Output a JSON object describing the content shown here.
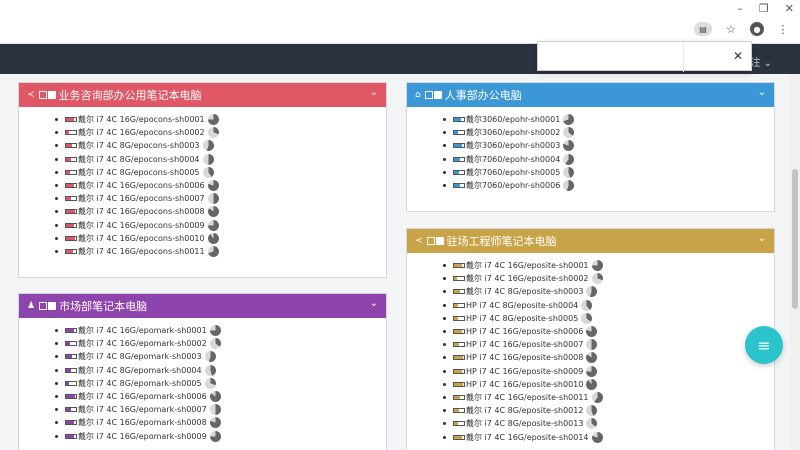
{
  "chrome": {
    "minimize": "–",
    "restore": "❐",
    "close": "✕",
    "icons": [
      "clipboard-icon",
      "star-icon",
      "profile-icon",
      "menu-icon"
    ]
  },
  "header": {
    "right_text": "注 ⌄"
  },
  "popup": {
    "close": "✕"
  },
  "panels": [
    {
      "id": "consult",
      "title": "业务咨询部办公用笔记本电脑",
      "color": "#e05766",
      "icon": "share-icon",
      "items": [
        {
          "label": "戴尔 i7 4C 16G/epocons-sh0001",
          "pie": 0.75
        },
        {
          "label": "戴尔 i7 4C 16G/epocons-sh0002",
          "pie": 0.3
        },
        {
          "label": "戴尔 i7 4C 8G/epocons-sh0003",
          "pie": 0.55
        },
        {
          "label": "戴尔 i7 4C 8G/epocons-sh0004",
          "pie": 0.5
        },
        {
          "label": "戴尔 i7 4C 8G/epocons-sh0005",
          "pie": 0.4
        },
        {
          "label": "戴尔 i7 4C 16G/epocons-sh0006",
          "pie": 0.8
        },
        {
          "label": "戴尔 i7 4C 16G/epocons-sh0007",
          "pie": 0.5
        },
        {
          "label": "戴尔 i7 4C 16G/epocons-sh0008",
          "pie": 0.85
        },
        {
          "label": "戴尔 i7 4C 16G/epocons-sh0009",
          "pie": 0.75
        },
        {
          "label": "戴尔 i7 4C 16G/epocons-sh0010",
          "pie": 0.9
        },
        {
          "label": "戴尔 i7 4C 16G/epocons-sh0011",
          "pie": 0.7
        }
      ]
    },
    {
      "id": "market",
      "title": "市场部笔记本电脑",
      "color": "#8e44ad",
      "icon": "users-icon",
      "items": [
        {
          "label": "戴尔 i7 4C 16G/epomark-sh0001",
          "pie": 0.75
        },
        {
          "label": "戴尔 i7 4C 16G/epomark-sh0002",
          "pie": 0.35
        },
        {
          "label": "戴尔 i7 4C 8G/epomark-sh0003",
          "pie": 0.55
        },
        {
          "label": "戴尔 i7 4C 8G/epomark-sh0004",
          "pie": 0.45
        },
        {
          "label": "戴尔 i7 4C 8G/epomark-sh0005",
          "pie": 0.3
        },
        {
          "label": "戴尔 i7 4C 16G/epomark-sh0006",
          "pie": 0.85
        },
        {
          "label": "戴尔 i7 4C 16G/epomark-sh0007",
          "pie": 0.5
        },
        {
          "label": "戴尔 i7 4C 16G/epomark-sh0008",
          "pie": 0.8
        },
        {
          "label": "戴尔 i7 4C 16G/epomark-sh0009",
          "pie": 0.75
        }
      ]
    },
    {
      "id": "hr",
      "title": "人事部办公电脑",
      "color": "#3c97d7",
      "icon": "home-icon",
      "items": [
        {
          "label": "戴尔3060/epohr-sh0001",
          "pie": 0.7
        },
        {
          "label": "戴尔3060/epohr-sh0002",
          "pie": 0.35
        },
        {
          "label": "戴尔3060/epohr-sh0003",
          "pie": 0.8
        },
        {
          "label": "戴尔7060/epohr-sh0004",
          "pie": 0.6
        },
        {
          "label": "戴尔7060/epohr-sh0005",
          "pie": 0.45
        },
        {
          "label": "戴尔7060/epohr-sh0006",
          "pie": 0.55
        }
      ]
    },
    {
      "id": "onsite",
      "title": "驻场工程师笔记本电脑",
      "color": "#c9a348",
      "icon": "share-icon",
      "items": [
        {
          "label": "戴尔 i7 4C 16G/eposite-sh0001",
          "pie": 0.75
        },
        {
          "label": "戴尔 i7 4C 16G/eposite-sh0002",
          "pie": 0.3
        },
        {
          "label": "戴尔 i7 4C 8G/eposite-sh0003",
          "pie": 0.55
        },
        {
          "label": "HP i7 4C 8G/eposite-sh0004",
          "pie": 0.4
        },
        {
          "label": "HP i7 4C 8G/eposite-sh0005",
          "pie": 0.35
        },
        {
          "label": "HP i7 4C 16G/eposite-sh0006",
          "pie": 0.8
        },
        {
          "label": "HP i7 4C 16G/eposite-sh0007",
          "pie": 0.5
        },
        {
          "label": "HP i7 4C 16G/eposite-sh0008",
          "pie": 0.85
        },
        {
          "label": "HP i7 4C 16G/eposite-sh0009",
          "pie": 0.75
        },
        {
          "label": "HP i7 4C 16G/eposite-sh0010",
          "pie": 0.9
        },
        {
          "label": "戴尔 i7 4C 16G/eposite-sh0011",
          "pie": 0.6
        },
        {
          "label": "戴尔 i7 4C 8G/eposite-sh0012",
          "pie": 0.45
        },
        {
          "label": "戴尔 i7 4C 8G/eposite-sh0013",
          "pie": 0.35
        },
        {
          "label": "戴尔 i7 4C 16G/eposite-sh0014",
          "pie": 0.8
        }
      ]
    }
  ],
  "fab": {
    "label": "≡"
  }
}
